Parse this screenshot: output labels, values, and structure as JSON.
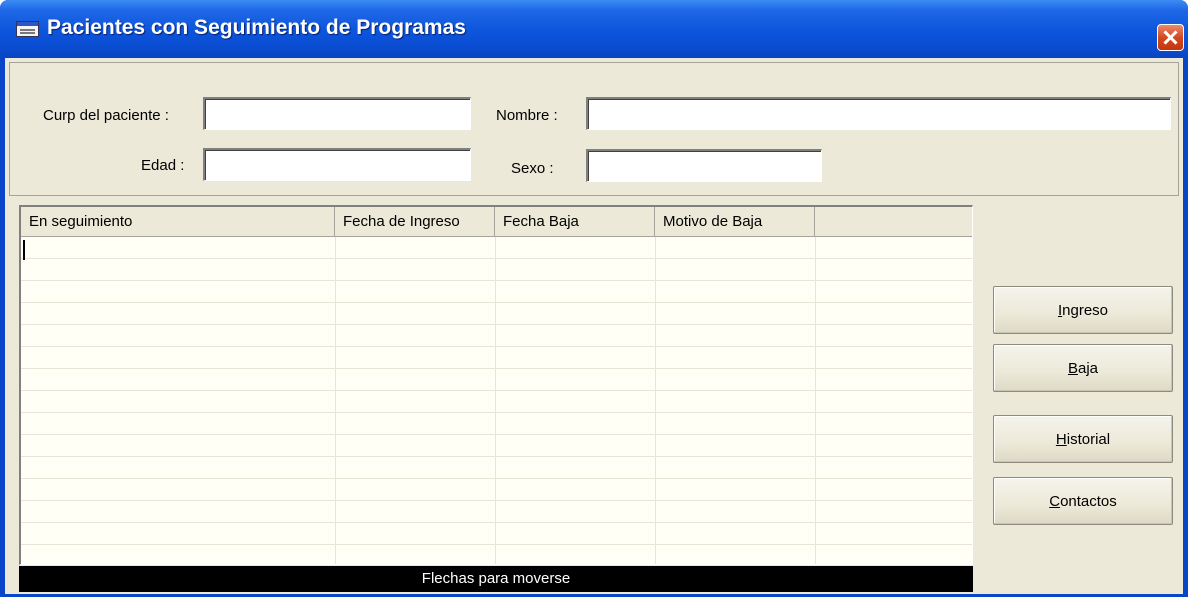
{
  "window": {
    "title": "Pacientes con Seguimiento de Programas"
  },
  "form": {
    "curp_label": "Curp del paciente :",
    "curp_value": "",
    "nombre_label": "Nombre :",
    "nombre_value": "",
    "edad_label": "Edad :",
    "edad_value": "",
    "sexo_label": "Sexo :",
    "sexo_value": ""
  },
  "grid": {
    "columns": [
      "En seguimiento",
      "Fecha de Ingreso",
      "Fecha Baja",
      "Motivo de Baja",
      ""
    ],
    "rows": []
  },
  "statusbar": {
    "text": "Flechas para moverse"
  },
  "buttons": {
    "ingreso": {
      "accel": "I",
      "rest": "ngreso"
    },
    "baja": {
      "accel": "B",
      "rest": "aja"
    },
    "historial": {
      "accel": "H",
      "rest": "istorial"
    },
    "contactos": {
      "accel": "C",
      "rest": "ontactos"
    }
  },
  "colors": {
    "titlebar": "#0a4bd0",
    "client_bg": "#ece9d8",
    "grid_bg": "#fffff6",
    "statusbar_bg": "#000000"
  },
  "icons": {
    "app": "window-app-icon",
    "close": "close-icon"
  }
}
